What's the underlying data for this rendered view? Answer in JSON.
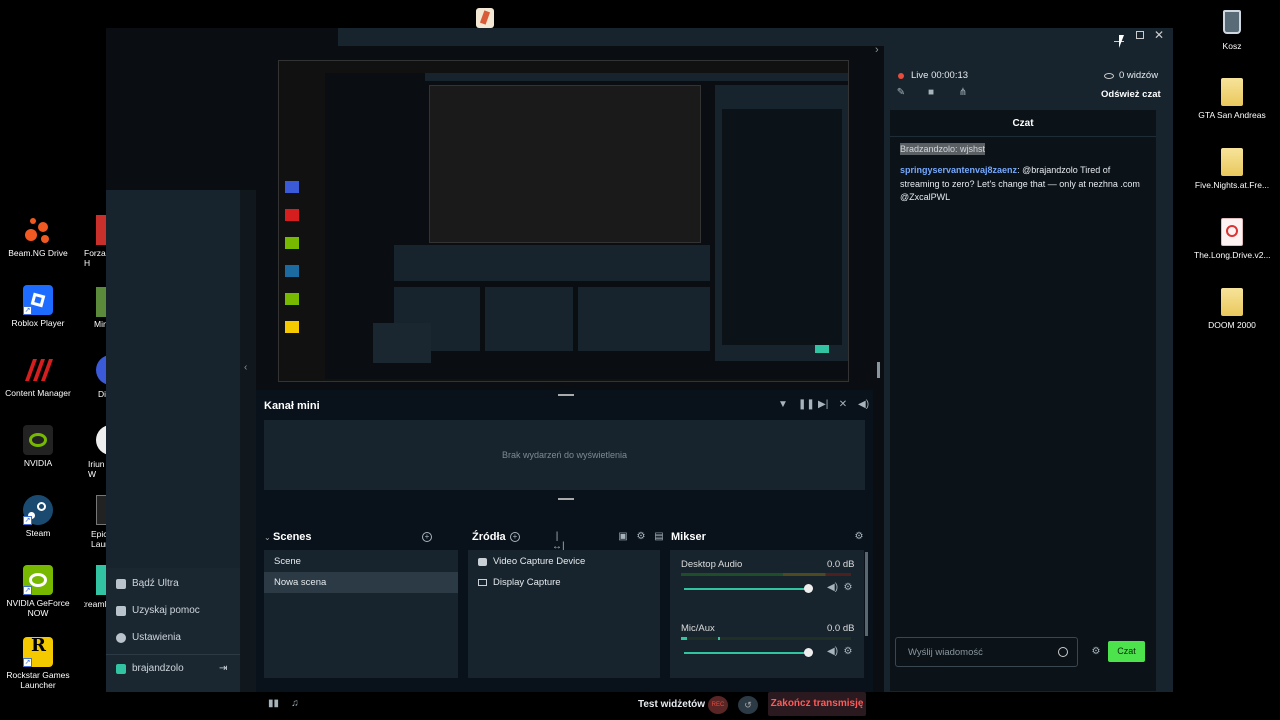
{
  "desktop": {
    "left_icons": [
      {
        "label": "Beam.NG Drive",
        "icon": "beamng-icon",
        "color": "#f05a22"
      },
      {
        "label": "Roblox Player",
        "icon": "roblox-icon",
        "color": "#1e6bff"
      },
      {
        "label": "Content Manager",
        "icon": "content-manager-icon",
        "color": "#d61e1e"
      },
      {
        "label": "NVIDIA",
        "icon": "nvidia-icon",
        "color": "#76b900"
      },
      {
        "label": "Steam",
        "icon": "steam-icon",
        "color": "#1b6aa0"
      },
      {
        "label": "NVIDIA GeForce NOW",
        "icon": "geforce-now-icon",
        "color": "#76b900"
      },
      {
        "label": "Rockstar Games Launcher",
        "icon": "rockstar-icon",
        "color": "#f5c900"
      }
    ],
    "partial_icons": [
      "Forza H",
      "Min",
      "Di",
      "Iriun W",
      "Epic Launc",
      "Streamla"
    ],
    "right_icons": [
      {
        "label": "Kosz",
        "icon": "recycle-bin-icon"
      },
      {
        "label": "GTA San Andreas",
        "icon": "folder-icon"
      },
      {
        "label": "Five.Nights.at.Fre...",
        "icon": "folder-icon"
      },
      {
        "label": "The.Long.Drive.v2...",
        "icon": "pdf-icon"
      },
      {
        "label": "DOOM 2000",
        "icon": "folder-icon"
      }
    ]
  },
  "nav": {
    "items": [
      {
        "label": "Bądź Ultra",
        "icon": "ultra-icon"
      },
      {
        "label": "Uzyskaj pomoc",
        "icon": "help-icon"
      },
      {
        "label": "Ustawienia",
        "icon": "gear-icon"
      }
    ],
    "user": "brajandzolo"
  },
  "editor": {
    "mini_feed_title": "Kanał mini",
    "mini_feed_empty": "Brak wydarzeń do wyświetlenia",
    "scenes_title": "Scenes",
    "scenes": [
      "Scene",
      "Nowa scena"
    ],
    "sources_title": "Źródła",
    "sources": [
      "Video Capture Device",
      "Display Capture"
    ],
    "mixer_title": "Mikser",
    "mixer": [
      {
        "name": "Desktop Audio",
        "db": "0.0 dB",
        "level": 0.9
      },
      {
        "name": "Mic/Aux",
        "db": "0.0 dB",
        "level": 0.9
      }
    ],
    "test_widgets": "Test widżetów",
    "rec": "REC",
    "end_stream": "Zakończ transmisję"
  },
  "chat": {
    "live_label": "Live 00:00:13",
    "viewers": "0 widzów",
    "refresh": "Odśwież czat",
    "title": "Czat",
    "highlight_user": "Bradzandzolo: wjshst",
    "message_user": "springyservantenvaj8zaenz",
    "message_text": "@brajandzolo Tired of streaming to zero? Let's change that — only at nezhna .com @ZxcalPWL",
    "input_placeholder": "Wyślij wiadomość",
    "send": "Czat",
    "accent": "#31c3a2"
  }
}
